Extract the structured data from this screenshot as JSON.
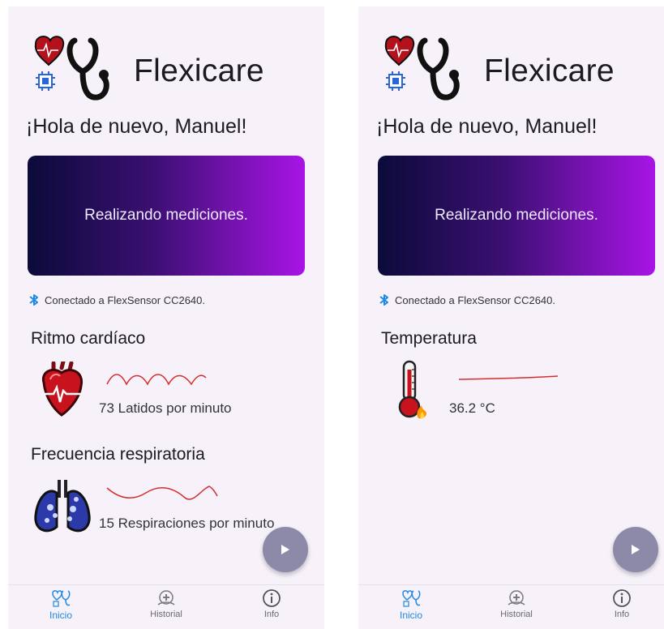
{
  "screens": [
    {
      "app_title": "Flexicare",
      "greeting": "¡Hola de nuevo, Manuel!",
      "banner_text": "Realizando mediciones.",
      "connection_text": "Conectado a FlexSensor CC2640.",
      "metrics": [
        {
          "title": "Ritmo cardíaco",
          "value": "73 Latidos por minuto",
          "icon": "heart-icon"
        },
        {
          "title": "Frecuencia respiratoria",
          "value": "15 Respiraciones por minuto",
          "icon": "lungs-icon"
        }
      ],
      "nav": [
        {
          "label": "Inicio",
          "icon": "home-icon"
        },
        {
          "label": "Historial",
          "icon": "history-icon"
        },
        {
          "label": "Info",
          "icon": "info-icon"
        }
      ]
    },
    {
      "app_title": "Flexicare",
      "greeting": "¡Hola de nuevo, Manuel!",
      "banner_text": "Realizando mediciones.",
      "connection_text": "Conectado a FlexSensor CC2640.",
      "metrics": [
        {
          "title": "Temperatura",
          "value": "36.2 °C",
          "icon": "thermometer-icon"
        }
      ],
      "nav": [
        {
          "label": "Inicio",
          "icon": "home-icon"
        },
        {
          "label": "Historial",
          "icon": "history-icon"
        },
        {
          "label": "Info",
          "icon": "info-icon"
        }
      ]
    }
  ],
  "colors": {
    "accent": "#1e88e5",
    "wave": "#d32f2f",
    "fab": "#8c8aa8",
    "banner_start": "#0b0b3a",
    "banner_end": "#a814e6"
  }
}
